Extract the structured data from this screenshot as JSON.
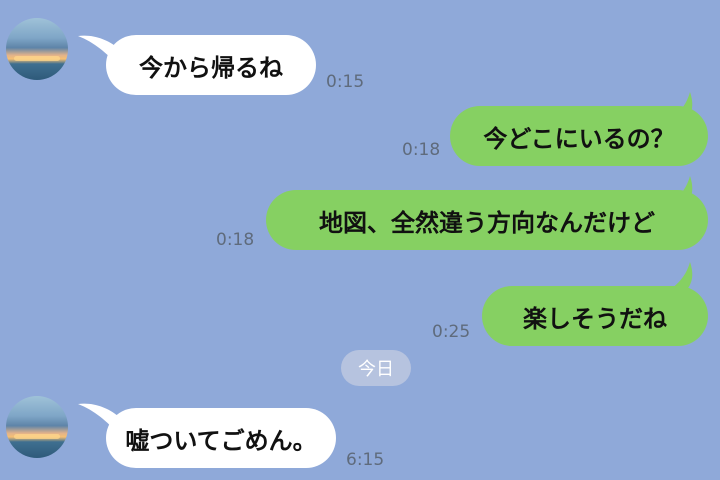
{
  "chat": {
    "messages": [
      {
        "side": "in",
        "text": "今から帰るね",
        "time": "0:15"
      },
      {
        "side": "out",
        "text": "今どこにいるの？",
        "time": "0:18"
      },
      {
        "side": "out",
        "text": "地図、全然違う方向なんだけど",
        "time": "0:18"
      },
      {
        "side": "out",
        "text": "楽しそうだね",
        "time": "0:25"
      },
      {
        "side": "in",
        "text": "嘘ついてごめん。",
        "time": "6:15"
      }
    ],
    "date_separator": "今日"
  },
  "colors": {
    "background": "#8fa9d9",
    "incoming_bubble": "#ffffff",
    "outgoing_bubble": "#86d062",
    "timestamp": "#5f6b7c"
  }
}
